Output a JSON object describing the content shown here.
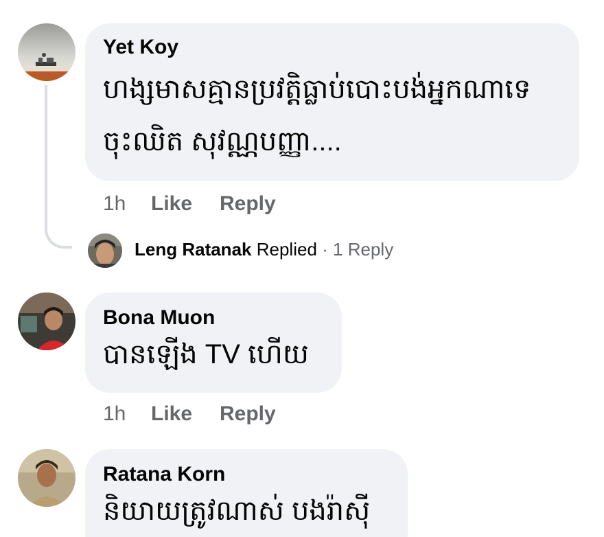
{
  "comments": [
    {
      "author": "Yet Koy",
      "text_line1": "ហង្សមាសគ្មានប្រវត្តិធ្លាប់បោះបង់អ្នកណាទេ",
      "text_line2": "ចុះឈិត សុវណ្ណបញ្ញា....",
      "time": "1h",
      "like": "Like",
      "reply": "Reply",
      "reply_summary": {
        "name": "Leng Ratanak",
        "action": "Replied",
        "separator": "·",
        "count": "1 Reply"
      }
    },
    {
      "author": "Bona Muon",
      "text_line1": "បានឡើង TV ហើយ",
      "time": "1h",
      "like": "Like",
      "reply": "Reply"
    },
    {
      "author": "Ratana Korn",
      "text_line1": "និយាយត្រូវណាស់ បងរ៉ាស៊ី"
    }
  ],
  "colors": {
    "bubble": "#f0f2f5",
    "meta": "#65676b",
    "text": "#050505",
    "thread_line": "#dadde1"
  }
}
